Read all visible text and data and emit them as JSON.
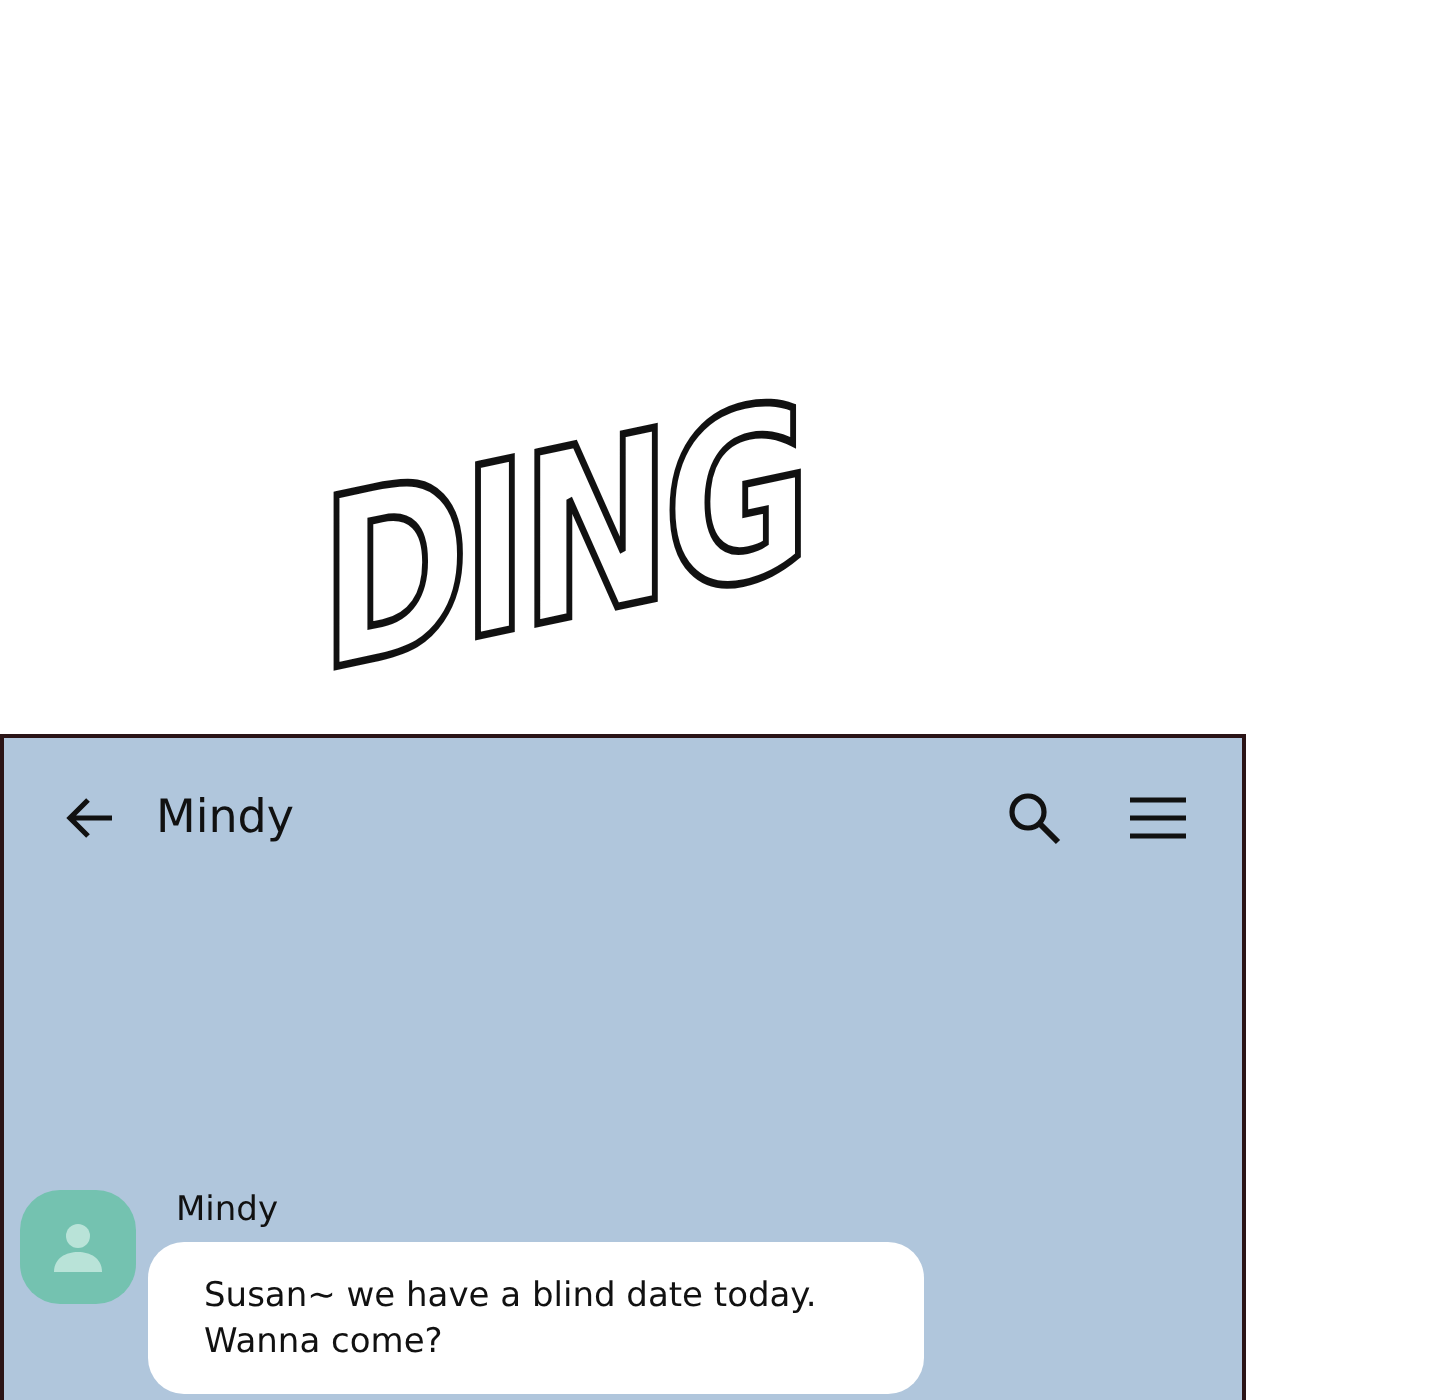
{
  "sound_effect": "DING",
  "chat": {
    "title": "Mindy",
    "messages": [
      {
        "sender": "Mindy",
        "text": "Susan~ we have a blind date today.\nWanna come?"
      }
    ]
  }
}
